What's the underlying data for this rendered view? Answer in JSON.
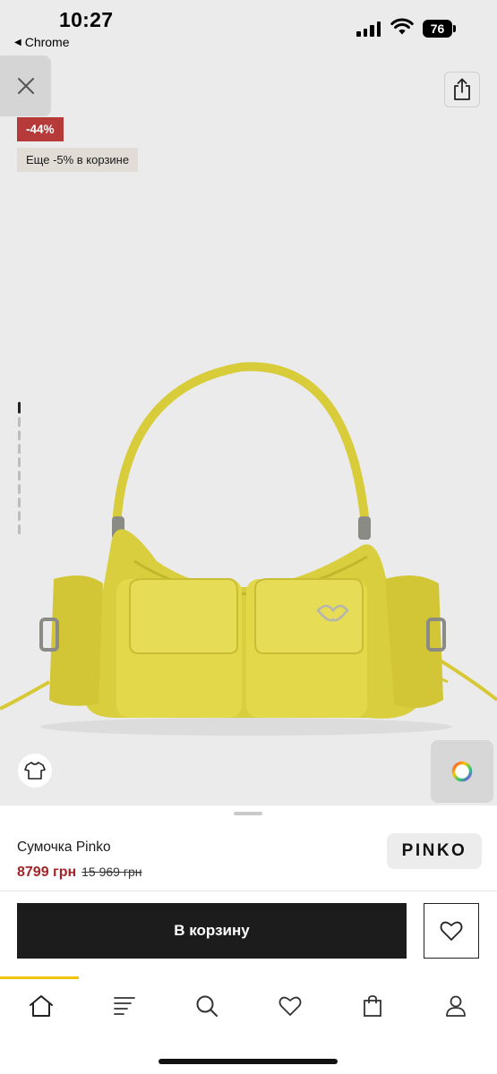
{
  "status_bar": {
    "time": "10:27",
    "back_app": "Chrome",
    "back_arrow": "◀",
    "battery": "76"
  },
  "gallery": {
    "discount_badge": "-44%",
    "extra_discount_badge": "Еще -5% в корзине",
    "pager": {
      "total": 10,
      "active_index": 1
    },
    "close_icon": "close-icon",
    "share_icon": "share-icon",
    "outfit_icon": "tshirt-icon",
    "color_icon": "color-wheel-icon"
  },
  "product": {
    "name": "Сумочка Pinko",
    "price": "8799 грн",
    "old_price": "15 969 грн",
    "brand": "PINKO",
    "bag_color": "#e0d23d"
  },
  "actions": {
    "add_to_cart": "В корзину",
    "favorite_icon": "heart-icon"
  },
  "tabbar": {
    "items": [
      "home-icon",
      "menu-icon",
      "search-icon",
      "heart-icon",
      "bag-icon",
      "profile-icon"
    ],
    "active": "home-icon",
    "accent": "#f2c500"
  }
}
